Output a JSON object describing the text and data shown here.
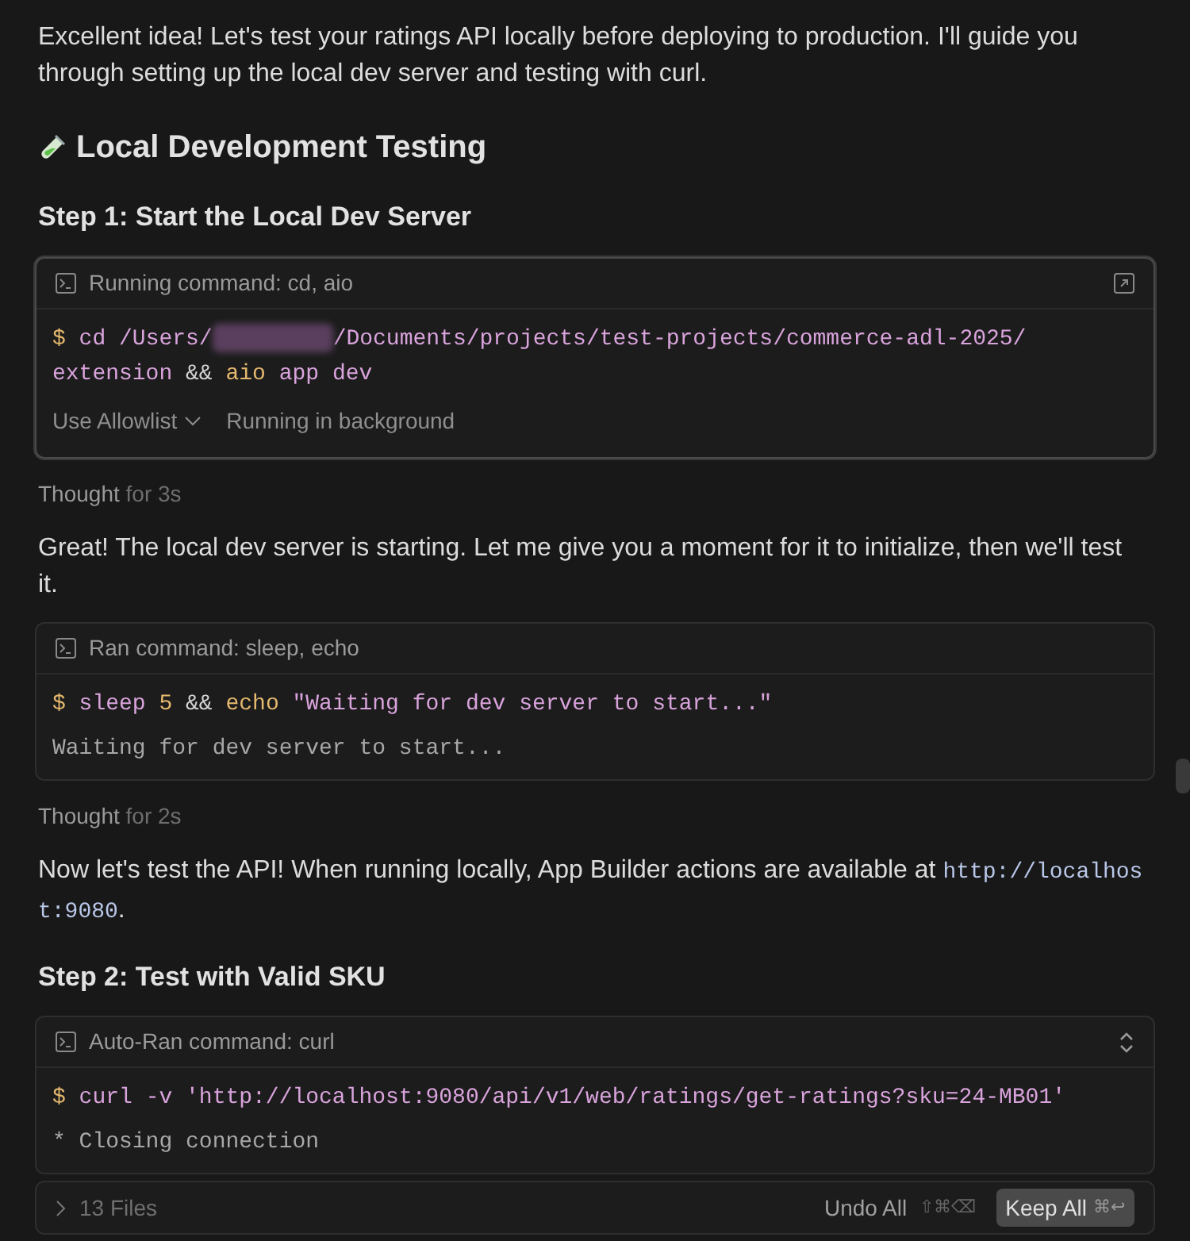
{
  "blocks": [
    {
      "kind": "paragraph",
      "text": "Excellent idea! Let's test your ratings API locally before deploying to production. I'll guide you through setting up the local dev server and testing with curl."
    },
    {
      "kind": "heading",
      "text": "Local Development Testing"
    },
    {
      "kind": "subheading",
      "text": "Step 1: Start the Local Dev Server"
    },
    {
      "kind": "command",
      "title": "Running command: cd, aio",
      "active": true,
      "header_control": {
        "kind": "open"
      },
      "lines": [
        [
          {
            "kind": "prompt",
            "s": "$"
          },
          {
            "kind": "cmd",
            "s": " cd /Users/"
          },
          {
            "kind": "redacted"
          },
          {
            "kind": "cmd",
            "s": "/Documents/projects/test-projects/commerce-adl-2025/"
          }
        ],
        [
          {
            "kind": "cmd",
            "s": "extension"
          },
          {
            "kind": "op",
            "s": " && "
          },
          {
            "kind": "kw",
            "s": "aio"
          },
          {
            "kind": "cmd",
            "s": " app dev"
          }
        ]
      ],
      "allowlist": "Use Allowlist",
      "status": "Running in background"
    },
    {
      "kind": "thought",
      "label": "Thought",
      "duration": "for 3s"
    },
    {
      "kind": "paragraph",
      "text": "Great! The local dev server is starting. Let me give you a moment for it to initialize, then we'll test it."
    },
    {
      "kind": "command",
      "title": "Ran command: sleep, echo",
      "active": false,
      "lines": [
        [
          {
            "kind": "prompt",
            "s": "$"
          },
          {
            "kind": "cmd",
            "s": " sleep "
          },
          {
            "kind": "kw",
            "s": "5"
          },
          {
            "kind": "op",
            "s": " && "
          },
          {
            "kind": "kw",
            "s": "echo"
          },
          {
            "kind": "cmd",
            "s": " \"Waiting for dev server to start...\""
          }
        ]
      ],
      "output": [
        "Waiting for dev server to start..."
      ]
    },
    {
      "kind": "thought",
      "label": "Thought",
      "duration": "for 2s"
    },
    {
      "kind": "paragraph_code",
      "text": "Now let's test the API! When running locally, App Builder actions are available at ",
      "code": "http://localhost:9080",
      "after": "."
    },
    {
      "kind": "subheading",
      "text": "Step 2: Test with Valid SKU"
    },
    {
      "kind": "command",
      "title": "Auto-Ran command: curl",
      "active": false,
      "header_control": {
        "kind": "expand"
      },
      "lines": [
        [
          {
            "kind": "prompt",
            "s": "$"
          },
          {
            "kind": "cmd",
            "s": " curl -v 'http://localhost:9080/api/v1/web/ratings/get-ratings?sku=24-MB01'"
          }
        ]
      ],
      "output": [
        "* Closing connection"
      ]
    }
  ],
  "review_bar": {
    "files": "13 Files",
    "undo": "Undo All",
    "undo_shortcut": "⇧⌘⌫",
    "keep": "Keep All",
    "keep_shortcut": "⌘↩"
  }
}
